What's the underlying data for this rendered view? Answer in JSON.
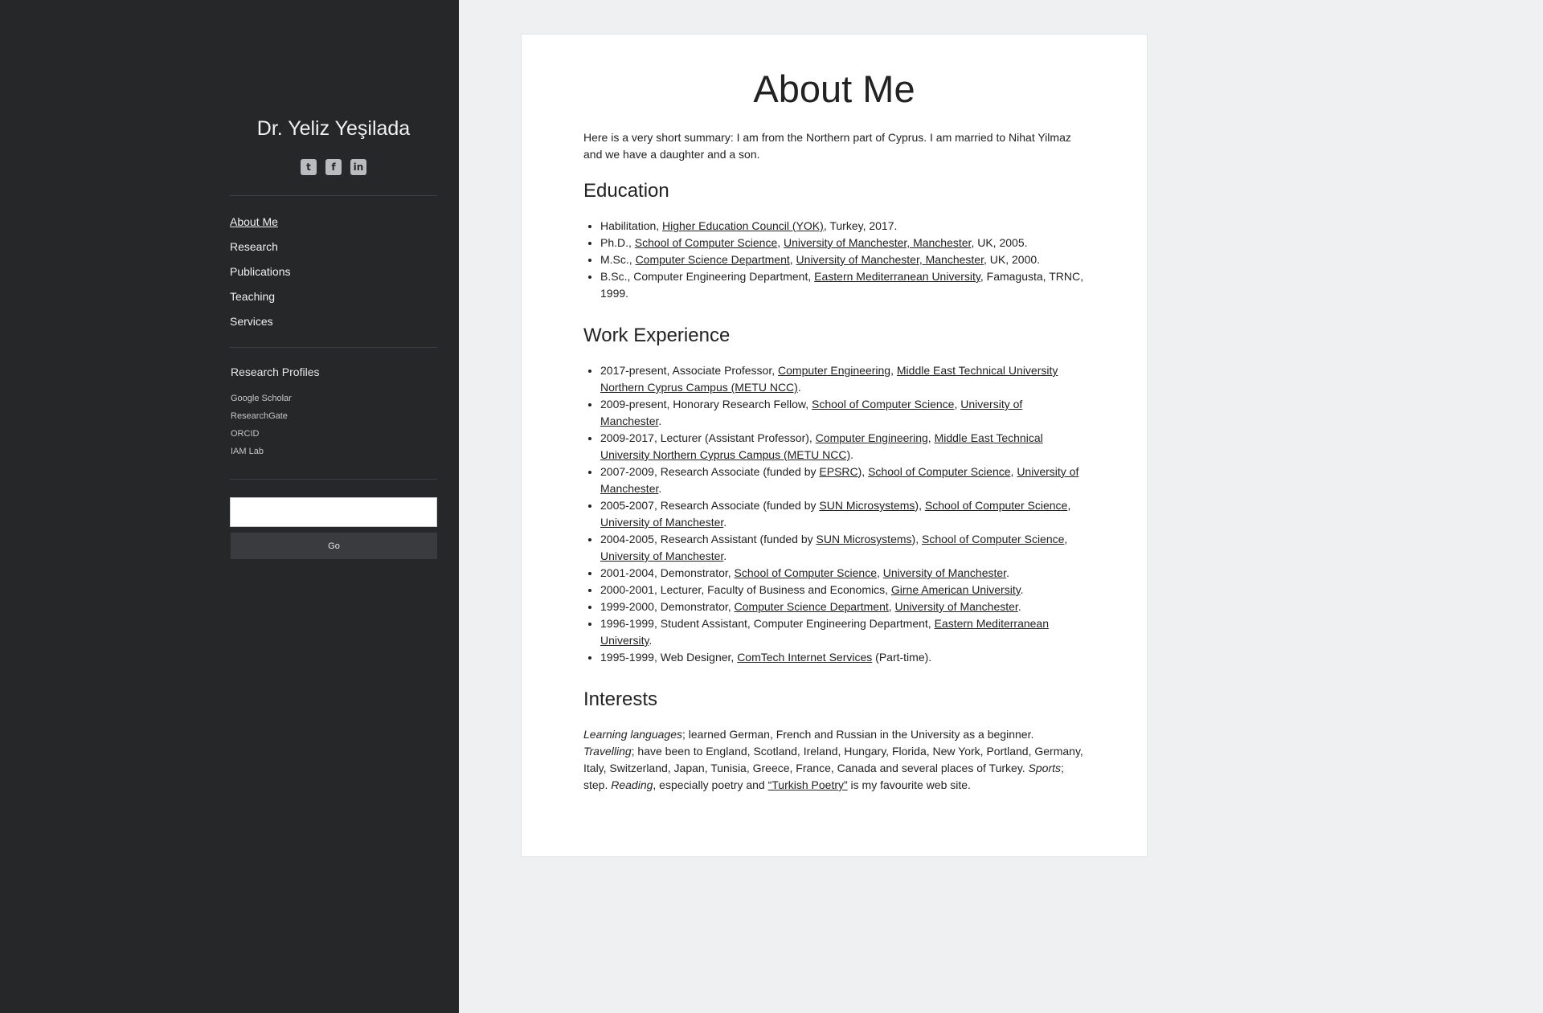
{
  "sidebar": {
    "title": "Dr. Yeliz Yeşilada",
    "social": [
      {
        "icon": "twitter-icon",
        "glyph": "t"
      },
      {
        "icon": "facebook-icon",
        "glyph": "f"
      },
      {
        "icon": "linkedin-icon",
        "glyph": "in"
      }
    ],
    "nav": [
      "About Me",
      "Research",
      "Publications",
      "Teaching",
      "Services"
    ],
    "profiles_title": "Research Profiles",
    "profiles": [
      "Google Scholar",
      "ResearchGate",
      "ORCID",
      "IAM Lab"
    ],
    "search": {
      "value": "",
      "button": "Go"
    }
  },
  "main": {
    "title": "About Me",
    "intro": "Here is a very short summary: I am from the Northern part of Cyprus. I am married to Nihat Yilmaz and we have a daughter and a son.",
    "sections": [
      {
        "heading": "Education",
        "items": [
          [
            {
              "t": "Habilitation, "
            },
            {
              "a": "Higher Education Council (YOK)"
            },
            {
              "t": ", Turkey, 2017."
            }
          ],
          [
            {
              "t": "Ph.D., "
            },
            {
              "a": "School of Computer Science"
            },
            {
              "t": ", "
            },
            {
              "a": "University of Manchester, Manchester"
            },
            {
              "t": ", UK, 2005."
            }
          ],
          [
            {
              "t": "M.Sc., "
            },
            {
              "a": "Computer Science Department"
            },
            {
              "t": ", "
            },
            {
              "a": "University of Manchester, Manchester"
            },
            {
              "t": ", UK, 2000."
            }
          ],
          [
            {
              "t": "B.Sc., Computer Engineering Department, "
            },
            {
              "a": "Eastern Mediterranean University"
            },
            {
              "t": ", Famagusta, TRNC, 1999."
            }
          ]
        ]
      },
      {
        "heading": "Work Experience",
        "items": [
          [
            {
              "t": "2017-present, Associate Professor, "
            },
            {
              "a": "Computer Engineering"
            },
            {
              "t": ", "
            },
            {
              "a": "Middle East Technical University Northern Cyprus Campus (METU NCC)"
            },
            {
              "t": "."
            }
          ],
          [
            {
              "t": "2009-present, Honorary Research Fellow, "
            },
            {
              "a": "School of Computer Science"
            },
            {
              "t": ", "
            },
            {
              "a": "University of Manchester"
            },
            {
              "t": "."
            }
          ],
          [
            {
              "t": "2009-2017, Lecturer (Assistant Professor), "
            },
            {
              "a": "Computer Engineering"
            },
            {
              "t": ", "
            },
            {
              "a": "Middle East Technical University Northern Cyprus Campus (METU NCC)"
            },
            {
              "t": "."
            }
          ],
          [
            {
              "t": "2007-2009, Research Associate (funded by "
            },
            {
              "a": "EPSRC"
            },
            {
              "t": "), "
            },
            {
              "a": "School of Computer Science"
            },
            {
              "t": ", "
            },
            {
              "a": "University of Manchester"
            },
            {
              "t": "."
            }
          ],
          [
            {
              "t": "2005-2007, Research Associate (funded by "
            },
            {
              "a": "SUN Microsystems"
            },
            {
              "t": "), "
            },
            {
              "a": "School of Computer Science"
            },
            {
              "t": ", "
            },
            {
              "a": "University of Manchester"
            },
            {
              "t": "."
            }
          ],
          [
            {
              "t": "2004-2005, Research Assistant (funded by "
            },
            {
              "a": "SUN Microsystems"
            },
            {
              "t": "), "
            },
            {
              "a": "School of Computer Science"
            },
            {
              "t": ", "
            },
            {
              "a": "University of Manchester"
            },
            {
              "t": "."
            }
          ],
          [
            {
              "t": "2001-2004, Demonstrator, "
            },
            {
              "a": "School of Computer Science"
            },
            {
              "t": ", "
            },
            {
              "a": "University of Manchester"
            },
            {
              "t": "."
            }
          ],
          [
            {
              "t": "2000-2001, Lecturer, Faculty of Business and Economics, "
            },
            {
              "a": "Girne American University"
            },
            {
              "t": "."
            }
          ],
          [
            {
              "t": "1999-2000, Demonstrator, "
            },
            {
              "a": "Computer Science Department"
            },
            {
              "t": ", "
            },
            {
              "a": "University of Manchester"
            },
            {
              "t": "."
            }
          ],
          [
            {
              "t": "1996-1999, Student Assistant, Computer Engineering Department, "
            },
            {
              "a": "Eastern Mediterranean University"
            },
            {
              "t": "."
            }
          ],
          [
            {
              "t": "1995-1999, Web Designer, "
            },
            {
              "a": "ComTech Internet Services"
            },
            {
              "t": " (Part-time)."
            }
          ]
        ]
      }
    ],
    "interests": {
      "heading": "Interests",
      "text": [
        {
          "em": "Learning languages"
        },
        {
          "t": "; learned German, French and Russian in the University as a beginner. "
        },
        {
          "em": "Travelling"
        },
        {
          "t": "; have been to England, Scotland, Ireland, Hungary, Florida, New York, Portland, Germany, Italy, Switzerland, Japan, Tunisia, Greece, France, Canada and several places of Turkey. "
        },
        {
          "em": "Sports"
        },
        {
          "t": "; step. "
        },
        {
          "em": "Reading"
        },
        {
          "t": ", especially poetry and "
        },
        {
          "a": "“Turkish Poetry”"
        },
        {
          "t": " is my favourite web site."
        }
      ]
    }
  }
}
